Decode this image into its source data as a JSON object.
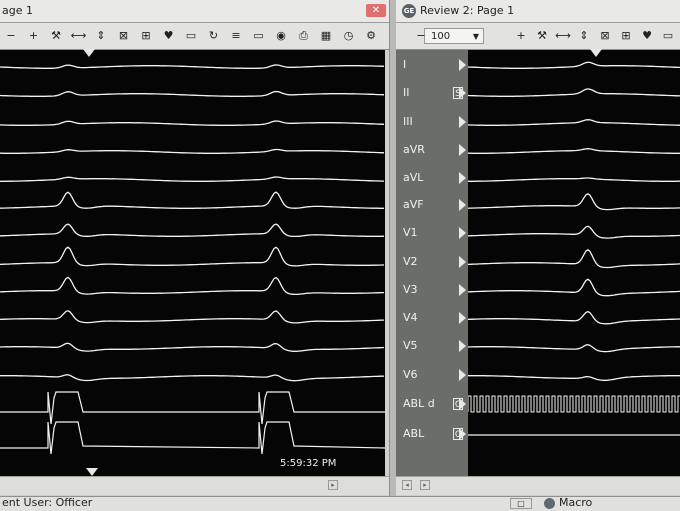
{
  "left_window": {
    "title": "age 1",
    "close_label": "✕",
    "time_label": "5:59:32 PM",
    "toolbar": [
      {
        "name": "zoom-out-button",
        "glyph": "−"
      },
      {
        "name": "zoom-in-button",
        "glyph": "+"
      },
      {
        "name": "tools-button",
        "glyph": "⚒"
      },
      {
        "name": "horizontal-caliper-button",
        "glyph": "⟷"
      },
      {
        "name": "vertical-caliper-button",
        "glyph": "⇕"
      },
      {
        "name": "remove-calipers-button",
        "glyph": "⊠"
      },
      {
        "name": "marching-caliper-button",
        "glyph": "⊞"
      },
      {
        "name": "beat-button",
        "glyph": "♥"
      },
      {
        "name": "monitor-button",
        "glyph": "▭"
      },
      {
        "name": "sync-button",
        "glyph": "↻"
      },
      {
        "name": "channel-button",
        "glyph": "≡"
      },
      {
        "name": "folder-button",
        "glyph": "▭"
      },
      {
        "name": "camera-button",
        "glyph": "◉"
      },
      {
        "name": "print-button",
        "glyph": "⎙"
      },
      {
        "name": "table-button",
        "glyph": "▦"
      },
      {
        "name": "clock-button",
        "glyph": "◷"
      },
      {
        "name": "settings-button",
        "glyph": "⚙"
      }
    ]
  },
  "right_window": {
    "title": "Review 2: Page 1",
    "close_label": "",
    "zoom_value": "100",
    "toolbar": [
      {
        "name": "zoom-out-button",
        "glyph": "−"
      },
      {
        "name": "zoom-in-button",
        "glyph": "+"
      },
      {
        "name": "tools-button",
        "glyph": "⚒"
      },
      {
        "name": "horizontal-caliper-button",
        "glyph": "⟷"
      },
      {
        "name": "vertical-caliper-button",
        "glyph": "⇕"
      },
      {
        "name": "remove-calipers-button",
        "glyph": "⊠"
      },
      {
        "name": "marching-caliper-button",
        "glyph": "⊞"
      },
      {
        "name": "beat-button",
        "glyph": "♥"
      },
      {
        "name": "monitor-button",
        "glyph": "▭"
      }
    ]
  },
  "leads": [
    {
      "label": "I",
      "box": ""
    },
    {
      "label": "II",
      "box": "S"
    },
    {
      "label": "III",
      "box": ""
    },
    {
      "label": "aVR",
      "box": ""
    },
    {
      "label": "aVL",
      "box": ""
    },
    {
      "label": "aVF",
      "box": ""
    },
    {
      "label": "V1",
      "box": ""
    },
    {
      "label": "V2",
      "box": ""
    },
    {
      "label": "V3",
      "box": ""
    },
    {
      "label": "V4",
      "box": ""
    },
    {
      "label": "V5",
      "box": ""
    },
    {
      "label": "V6",
      "box": ""
    },
    {
      "label": "ABL d",
      "box": "C"
    },
    {
      "label": "ABL",
      "box": "C"
    }
  ],
  "status_bar": {
    "left_text": "ent User: Officer",
    "right_text": "Macro"
  },
  "colors": {
    "trace": "#f2f2ef",
    "background": "#050505",
    "lead_panel": "#6b6d69"
  }
}
